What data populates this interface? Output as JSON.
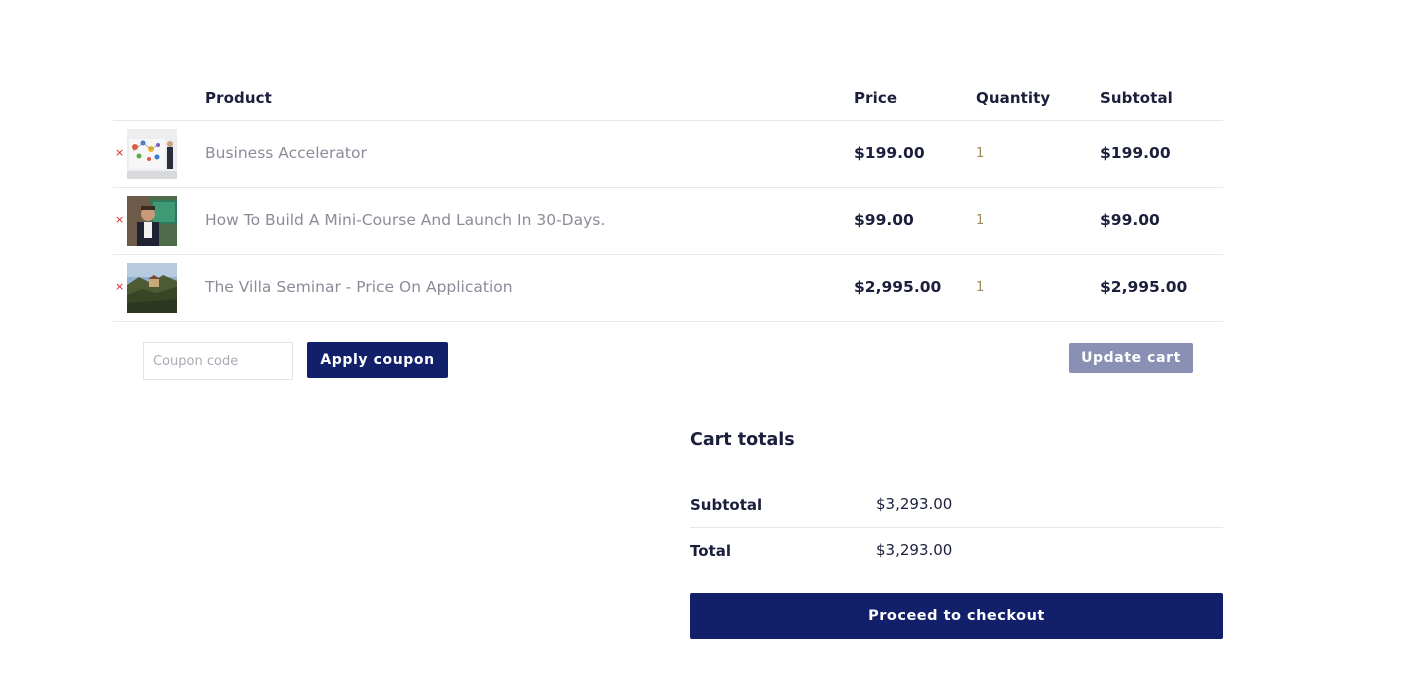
{
  "cart": {
    "headers": {
      "product": "Product",
      "price": "Price",
      "quantity": "Quantity",
      "subtotal": "Subtotal"
    },
    "remove_symbol": "×",
    "items": [
      {
        "name": "Business Accelerator",
        "price": "$199.00",
        "quantity": "1",
        "subtotal": "$199.00",
        "thumbnail": "whiteboard-presentation"
      },
      {
        "name": "How To Build A Mini-Course And Launch In 30-Days.",
        "price": "$99.00",
        "quantity": "1",
        "subtotal": "$99.00",
        "thumbnail": "presenter-portrait"
      },
      {
        "name": "The Villa Seminar - Price On Application",
        "price": "$2,995.00",
        "quantity": "1",
        "subtotal": "$2,995.00",
        "thumbnail": "villa-landscape"
      }
    ],
    "coupon": {
      "placeholder": "Coupon code",
      "value": "",
      "apply_label": "Apply coupon"
    },
    "update_label": "Update cart"
  },
  "totals": {
    "title": "Cart totals",
    "subtotal_label": "Subtotal",
    "subtotal_value": "$3,293.00",
    "total_label": "Total",
    "total_value": "$3,293.00",
    "checkout_label": "Proceed to checkout"
  },
  "colors": {
    "primary": "#121f6b",
    "disabled_button": "#8990b4",
    "remove": "#dd2222",
    "product_link": "#8a8c99"
  }
}
